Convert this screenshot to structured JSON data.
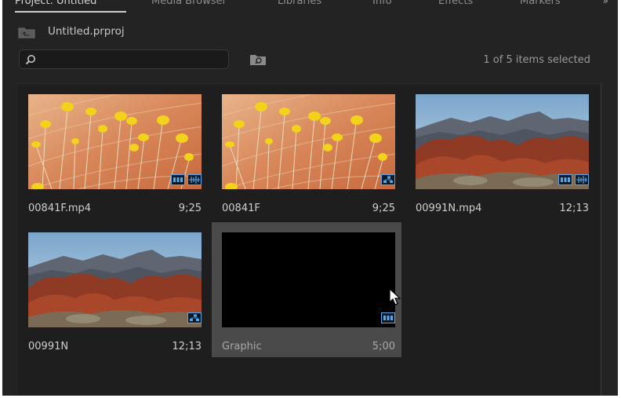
{
  "tabs": [
    {
      "label": "Project: Untitled",
      "active": true
    },
    {
      "label": "Media Browser",
      "active": false
    },
    {
      "label": "Libraries",
      "active": false
    },
    {
      "label": "Info",
      "active": false
    },
    {
      "label": "Effects",
      "active": false
    },
    {
      "label": "Markers",
      "active": false
    }
  ],
  "project": {
    "path_label": "Untitled.prproj"
  },
  "search": {
    "value": "",
    "placeholder": ""
  },
  "status": {
    "selection_text": "1 of 5 items selected"
  },
  "items": [
    {
      "name": "00841F.mp4",
      "duration": "9;25",
      "thumbnail": "yellow-flowers",
      "badges": [
        "video-icon",
        "audio-icon"
      ],
      "selected": false
    },
    {
      "name": "00841F",
      "duration": "9;25",
      "thumbnail": "yellow-flowers",
      "badges": [
        "sequence-icon"
      ],
      "selected": false
    },
    {
      "name": "00991N.mp4",
      "duration": "12;13",
      "thumbnail": "red-rock-landscape",
      "badges": [
        "video-icon",
        "audio-icon"
      ],
      "selected": false
    },
    {
      "name": "00991N",
      "duration": "12;13",
      "thumbnail": "red-rock-landscape",
      "badges": [
        "sequence-icon"
      ],
      "selected": false
    },
    {
      "name": "Graphic",
      "duration": "5;00",
      "thumbnail": "black",
      "badges": [
        "video-icon"
      ],
      "selected": true
    }
  ],
  "colors": {
    "panel_bg": "#232323",
    "grid_bg": "#1e1e1e",
    "selected_tile": "#4a4a4a",
    "badge_accent": "#59a6e6"
  }
}
